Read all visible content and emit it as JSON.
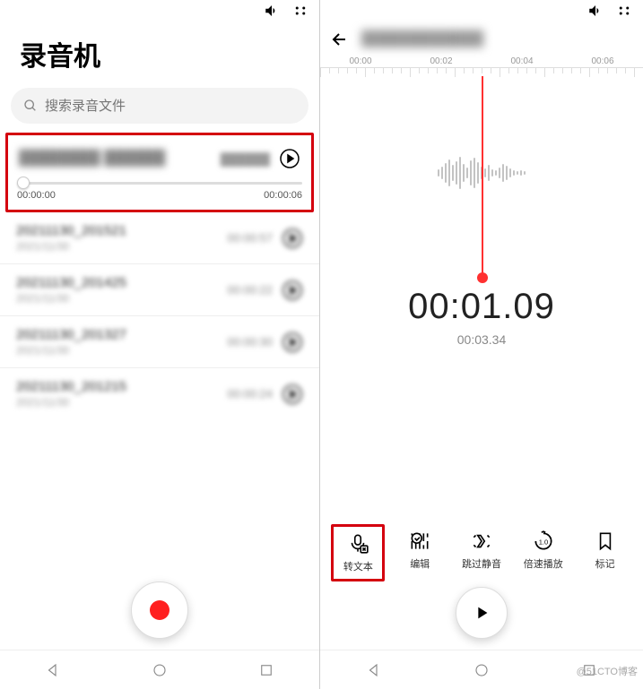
{
  "left": {
    "title": "录音机",
    "search_placeholder": "搜索录音文件",
    "selected": {
      "name": "████████ ██████",
      "info": "██████",
      "start": "00:00:00",
      "end": "00:00:06"
    },
    "items": [
      {
        "name": "20211130_201521",
        "date": "2021/11/30",
        "duration": "00:00:57"
      },
      {
        "name": "20211130_201425",
        "date": "2021/11/30",
        "duration": "00:00:22"
      },
      {
        "name": "20211130_201327",
        "date": "2021/11/30",
        "duration": "00:00:30"
      },
      {
        "name": "20211130_201215",
        "date": "2021/11/30",
        "duration": "00:00:24"
      }
    ]
  },
  "right": {
    "title": "████████████",
    "ticks": [
      "00:00",
      "00:02",
      "00:04",
      "00:06"
    ],
    "current_time": "00:01.09",
    "total_time": "00:03.34",
    "tools": [
      {
        "id": "transcribe",
        "label": "转文本"
      },
      {
        "id": "edit",
        "label": "编辑"
      },
      {
        "id": "skip-silence",
        "label": "跳过静音"
      },
      {
        "id": "speed",
        "label": "倍速播放"
      },
      {
        "id": "bookmark",
        "label": "标记"
      }
    ]
  },
  "watermark": "@51CTO博客"
}
